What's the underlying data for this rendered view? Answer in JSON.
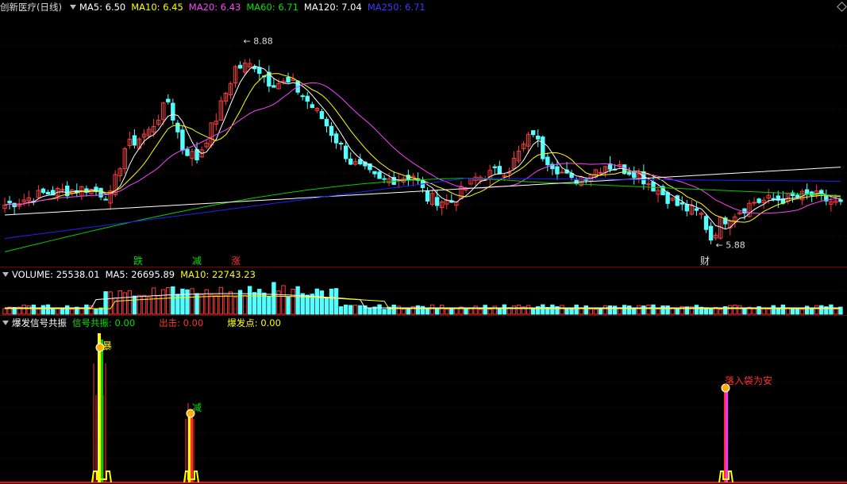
{
  "app": {
    "title": "创新医疗",
    "period": "(日线)"
  },
  "colors": {
    "up": "#ff3b3b",
    "down": "#54ffff",
    "ma5": "#ffffff",
    "ma10": "#ffff00",
    "ma20": "#ff40ff",
    "ma60": "#00d000",
    "ma120": "#ffffff",
    "ma250": "#2020ff",
    "grid": "#5a0000"
  },
  "price_header": {
    "ma5_label": "MA5:",
    "ma5_value": "6.50",
    "ma10_label": "MA10:",
    "ma10_value": "6.45",
    "ma20_label": "MA20:",
    "ma20_value": "6.43",
    "ma60_label": "MA60:",
    "ma60_value": "6.71",
    "ma120_label": "MA120:",
    "ma120_value": "7.04",
    "ma250_label": "MA250:",
    "ma250_value": "6.71"
  },
  "price_annotations": {
    "high_label": "8.88",
    "low_label": "5.88",
    "text_die": "跌",
    "text_jian": "减",
    "text_zhang": "涨",
    "text_cai": "财"
  },
  "volume_header": {
    "title": "VOLUME:",
    "value": "25538.01",
    "ma5_label": "MA5:",
    "ma5_value": "26695.89",
    "ma10_label": "MA10:",
    "ma10_value": "22743.23"
  },
  "signal_header": {
    "title": "爆发信号共振",
    "s1_label": "信号共振:",
    "s1_value": "0.00",
    "s2_label": "出击:",
    "s2_value": "0.00",
    "s3_label": "爆发点:",
    "s3_value": "0.00"
  },
  "signal_annotations": {
    "mark_left": "暴",
    "mark_mid": "减",
    "mark_right": "落入袋为安"
  },
  "chart_data": {
    "type": "candlestick",
    "ylim": [
      5.6,
      9.3
    ],
    "high": 8.88,
    "low": 5.88,
    "ma_last": {
      "MA5": 6.5,
      "MA10": 6.45,
      "MA20": 6.43,
      "MA60": 6.71,
      "MA120": 7.04,
      "MA250": 6.71
    },
    "volume_last": {
      "VOLUME": 25538.01,
      "MA5": 26695.89,
      "MA10": 22743.23
    }
  }
}
